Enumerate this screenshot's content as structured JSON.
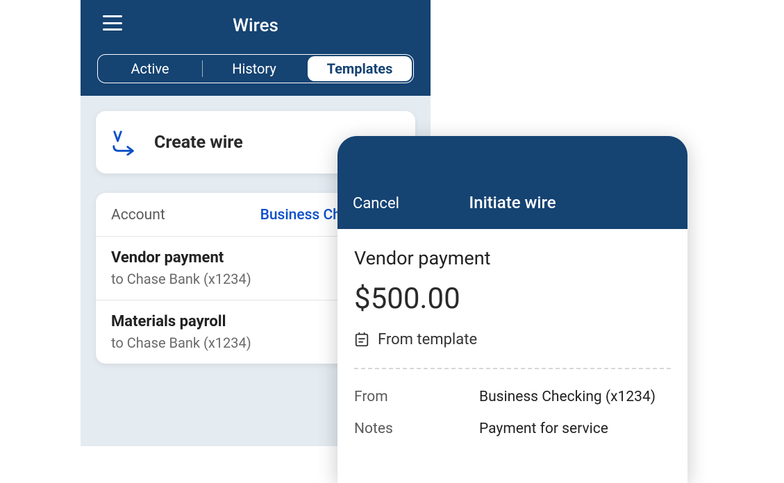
{
  "wires_screen": {
    "title": "Wires",
    "tabs": {
      "active": "Active",
      "history": "History",
      "templates": "Templates"
    },
    "create_wire_label": "Create wire",
    "account": {
      "label": "Account",
      "value": "Business Checking (x"
    },
    "templates": [
      {
        "name": "Vendor payment",
        "destination": "to Chase Bank (x1234)"
      },
      {
        "name": "Materials payroll",
        "destination": "to Chase Bank (x1234)"
      }
    ]
  },
  "initiate_wire": {
    "cancel": "Cancel",
    "title": "Initiate wire",
    "wire_name": "Vendor payment",
    "amount": "$500.00",
    "from_template_label": "From template",
    "details": {
      "from_label": "From",
      "from_value": "Business Checking (x1234)",
      "notes_label": "Notes",
      "notes_value": "Payment for service"
    }
  }
}
